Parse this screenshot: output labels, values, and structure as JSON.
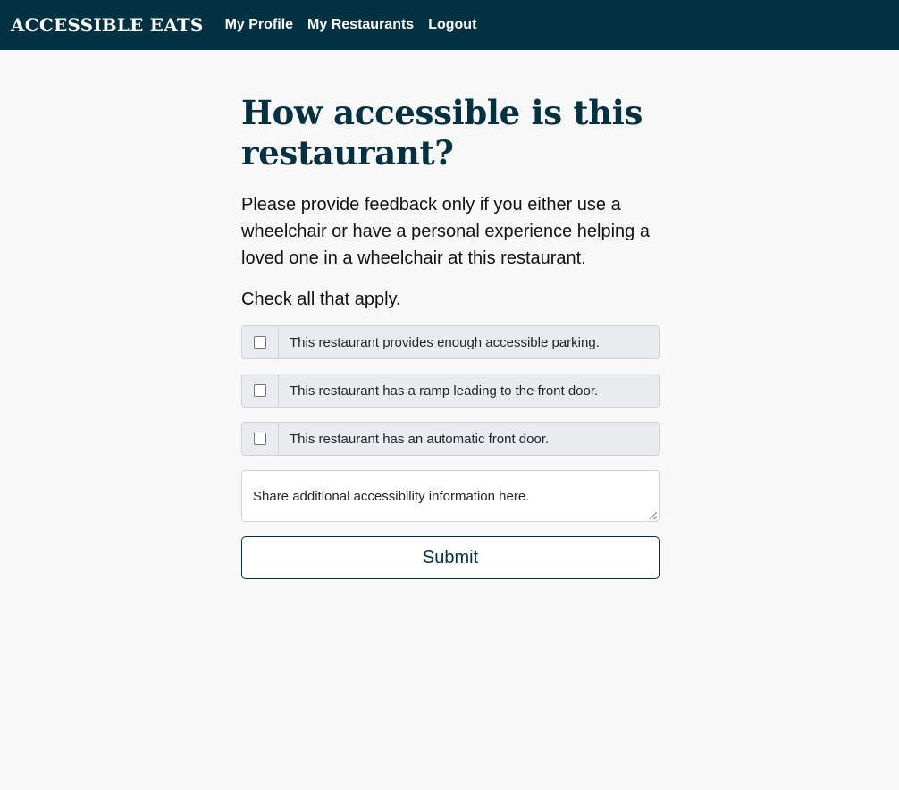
{
  "navbar": {
    "brand": "ACCESSIBLE EATS",
    "links": [
      "My Profile",
      "My Restaurants",
      "Logout"
    ],
    "bg_color": "#023141"
  },
  "main": {
    "heading": "How accessible is this restaurant?",
    "intro": "Please provide feedback only if you either use a wheelchair or have a personal experience helping a loved one in a wheelchair at this restaurant.",
    "check_all": "Check all that apply.",
    "checkboxes": [
      {
        "label": "This restaurant provides enough accessible parking.",
        "checked": false
      },
      {
        "label": "This restaurant has a ramp leading to the front door.",
        "checked": false
      },
      {
        "label": "This restaurant has an automatic front door.",
        "checked": false
      }
    ],
    "textarea_placeholder": "Share additional accessibility information here.",
    "submit_label": "Submit"
  }
}
